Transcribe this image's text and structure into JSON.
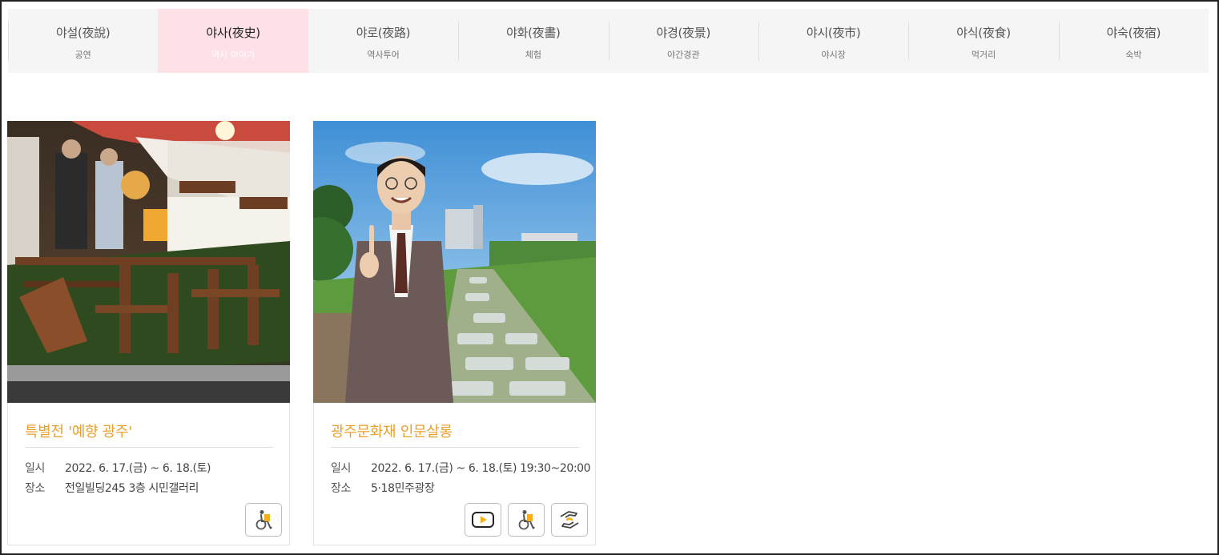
{
  "tabs": [
    {
      "label": "야설(夜說)",
      "sub": "공연",
      "active": false
    },
    {
      "label": "야사(夜史)",
      "sub": "역사 이야기",
      "active": true
    },
    {
      "label": "야로(夜路)",
      "sub": "역사투어",
      "active": false
    },
    {
      "label": "야화(夜畵)",
      "sub": "체험",
      "active": false
    },
    {
      "label": "야경(夜景)",
      "sub": "야간경관",
      "active": false
    },
    {
      "label": "야시(夜市)",
      "sub": "야시장",
      "active": false
    },
    {
      "label": "야식(夜食)",
      "sub": "먹거리",
      "active": false
    },
    {
      "label": "야숙(夜宿)",
      "sub": "숙박",
      "active": false
    }
  ],
  "cards": [
    {
      "title": "특별전 '예향 광주'",
      "date_label": "일시",
      "date_value": "2022. 6. 17.(금) ~ 6. 18.(토)",
      "place_label": "장소",
      "place_value": "전일빌딩245 3층 시민갤러리",
      "icons": [
        "wheelchair-icon"
      ]
    },
    {
      "title": "광주문화재 인문살롱",
      "date_label": "일시",
      "date_value": "2022. 6. 17.(금) ~ 6. 18.(토) 19:30~20:00",
      "place_label": "장소",
      "place_value": "5·18민주광장",
      "icons": [
        "video-play-icon",
        "wheelchair-icon",
        "sign-language-icon"
      ]
    }
  ],
  "colors": {
    "accent_title": "#e8a02c",
    "active_tab_bg": "#fde1e7",
    "tabbar_bg": "#f5f5f5",
    "icon_yellow": "#f3b01b"
  }
}
